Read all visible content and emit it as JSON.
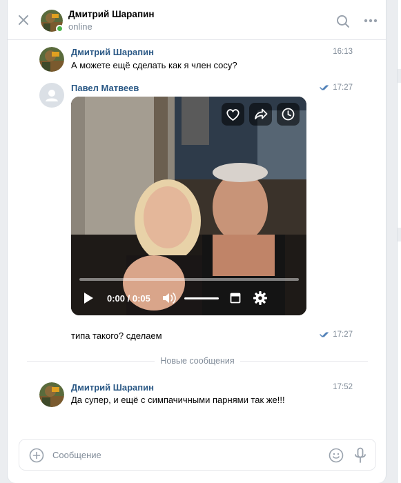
{
  "header": {
    "name": "Дмитрий Шарапин",
    "status": "online"
  },
  "messages": [
    {
      "author": "Дмитрий Шарапин",
      "time": "16:13",
      "text": "А можете ещё сделать как я член сосу?"
    },
    {
      "author": "Павел Матвеев",
      "time": "17:27",
      "read": true
    },
    {
      "text": "типа такого? сделаем",
      "time": "17:27",
      "read": true
    },
    {
      "author": "Дмитрий Шарапин",
      "time": "17:52",
      "text": "Да супер, и ещё с симпачичными парнями так же!!!"
    }
  ],
  "video": {
    "current_time": "0:00",
    "duration": "0:05",
    "time_label": "0:00 / 0:05",
    "progress": 0.0,
    "volume": 1.0
  },
  "divider": {
    "label": "Новые сообщения"
  },
  "composer": {
    "placeholder": "Сообщение",
    "value": ""
  },
  "icons": {
    "close": "close-icon",
    "search": "search-icon",
    "more": "more-icon",
    "like": "heart-icon",
    "share": "share-icon",
    "watch_later": "clock-icon",
    "play": "play-icon",
    "volume": "volume-icon",
    "miniplayer": "miniplayer-icon",
    "settings": "gear-icon",
    "attach": "plus-circle-icon",
    "emoji": "smile-icon",
    "mic": "microphone-icon"
  },
  "colors": {
    "author": "#2a5885",
    "meta": "#818c99",
    "online": "#4bb34b",
    "read_check": "#5181b8"
  }
}
